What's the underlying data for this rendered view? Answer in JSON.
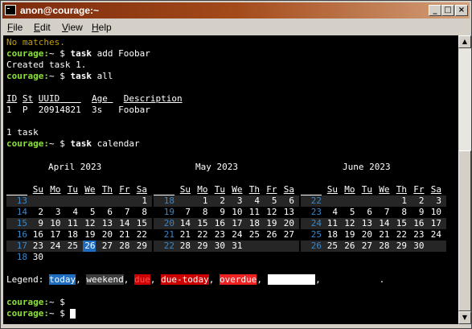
{
  "window": {
    "title": "anon@courage:~",
    "buttons": [
      "_",
      "□",
      "×"
    ]
  },
  "menu": [
    {
      "key": "F",
      "rest": "ile"
    },
    {
      "key": "E",
      "rest": "dit"
    },
    {
      "key": "V",
      "rest": "iew"
    },
    {
      "key": "H",
      "rest": "elp"
    }
  ],
  "terminal": {
    "no_matches": "No matches.",
    "prompt_host": "courage:",
    "prompt_path": "~ $ ",
    "cmd1_bold": "task",
    "cmd1_rest": " add Foobar",
    "created": "Created task 1.",
    "cmd2_bold": "task",
    "cmd2_rest": " all",
    "table_headers": [
      "ID",
      "St",
      "UUID",
      "Age",
      "Description"
    ],
    "table_row": [
      "1",
      "P",
      "20914821",
      "3s",
      "Foobar"
    ],
    "task_count": "1 task",
    "cmd3_bold": "task",
    "cmd3_rest": " calendar",
    "prompt_end": "~ $ "
  },
  "calendar": {
    "day_headers": [
      "Su",
      "Mo",
      "Tu",
      "We",
      "Th",
      "Fr",
      "Sa"
    ],
    "months": [
      {
        "title": "April 2023",
        "weeks": [
          {
            "wk": "13",
            "days": [
              "",
              "",
              "",
              "",
              "",
              "",
              "1"
            ]
          },
          {
            "wk": "14",
            "days": [
              "2",
              "3",
              "4",
              "5",
              "6",
              "7",
              "8"
            ]
          },
          {
            "wk": "15",
            "days": [
              "9",
              "10",
              "11",
              "12",
              "13",
              "14",
              "15"
            ]
          },
          {
            "wk": "16",
            "days": [
              "16",
              "17",
              "18",
              "19",
              "20",
              "21",
              "22"
            ]
          },
          {
            "wk": "17",
            "days": [
              "23",
              "24",
              "25",
              "26",
              "27",
              "28",
              "29"
            ]
          },
          {
            "wk": "18",
            "days": [
              "30",
              "",
              "",
              "",
              "",
              "",
              ""
            ]
          }
        ]
      },
      {
        "title": "May 2023",
        "weeks": [
          {
            "wk": "18",
            "days": [
              "",
              "1",
              "2",
              "3",
              "4",
              "5",
              "6"
            ]
          },
          {
            "wk": "19",
            "days": [
              "7",
              "8",
              "9",
              "10",
              "11",
              "12",
              "13"
            ]
          },
          {
            "wk": "20",
            "days": [
              "14",
              "15",
              "16",
              "17",
              "18",
              "19",
              "20"
            ]
          },
          {
            "wk": "21",
            "days": [
              "21",
              "22",
              "23",
              "24",
              "25",
              "26",
              "27"
            ]
          },
          {
            "wk": "22",
            "days": [
              "28",
              "29",
              "30",
              "31",
              "",
              "",
              ""
            ]
          }
        ]
      },
      {
        "title": "June 2023",
        "weeks": [
          {
            "wk": "22",
            "days": [
              "",
              "",
              "",
              "",
              "1",
              "2",
              "3"
            ]
          },
          {
            "wk": "23",
            "days": [
              "4",
              "5",
              "6",
              "7",
              "8",
              "9",
              "10"
            ]
          },
          {
            "wk": "24",
            "days": [
              "11",
              "12",
              "13",
              "14",
              "15",
              "16",
              "17"
            ]
          },
          {
            "wk": "25",
            "days": [
              "18",
              "19",
              "20",
              "21",
              "22",
              "23",
              "24"
            ]
          },
          {
            "wk": "26",
            "days": [
              "25",
              "26",
              "27",
              "28",
              "29",
              "30",
              ""
            ]
          }
        ]
      }
    ],
    "today": {
      "month": 0,
      "day": "26"
    },
    "legend": {
      "label": "Legend: ",
      "items": [
        {
          "text": "today",
          "bg": "#1f6dc0",
          "fg": "#ffffff"
        },
        {
          "text": "weekend",
          "bg": "#3c3c3c",
          "fg": "#ffffff"
        },
        {
          "text": "due",
          "bg": "#cc0000",
          "fg": "#ff5555"
        },
        {
          "text": "due-today",
          "bg": "#cc0000",
          "fg": "#ffffff"
        },
        {
          "text": "overdue",
          "bg": "#ee2222",
          "fg": "#ffffff"
        },
        {
          "text": "",
          "bg": "#ffffff",
          "fg": "#ffffff"
        }
      ],
      "tail": "."
    }
  },
  "colors": {
    "prompt": "#8ae234",
    "warning": "#c4a000",
    "week_number": "#3a86c8",
    "row_dark": "#262626"
  }
}
